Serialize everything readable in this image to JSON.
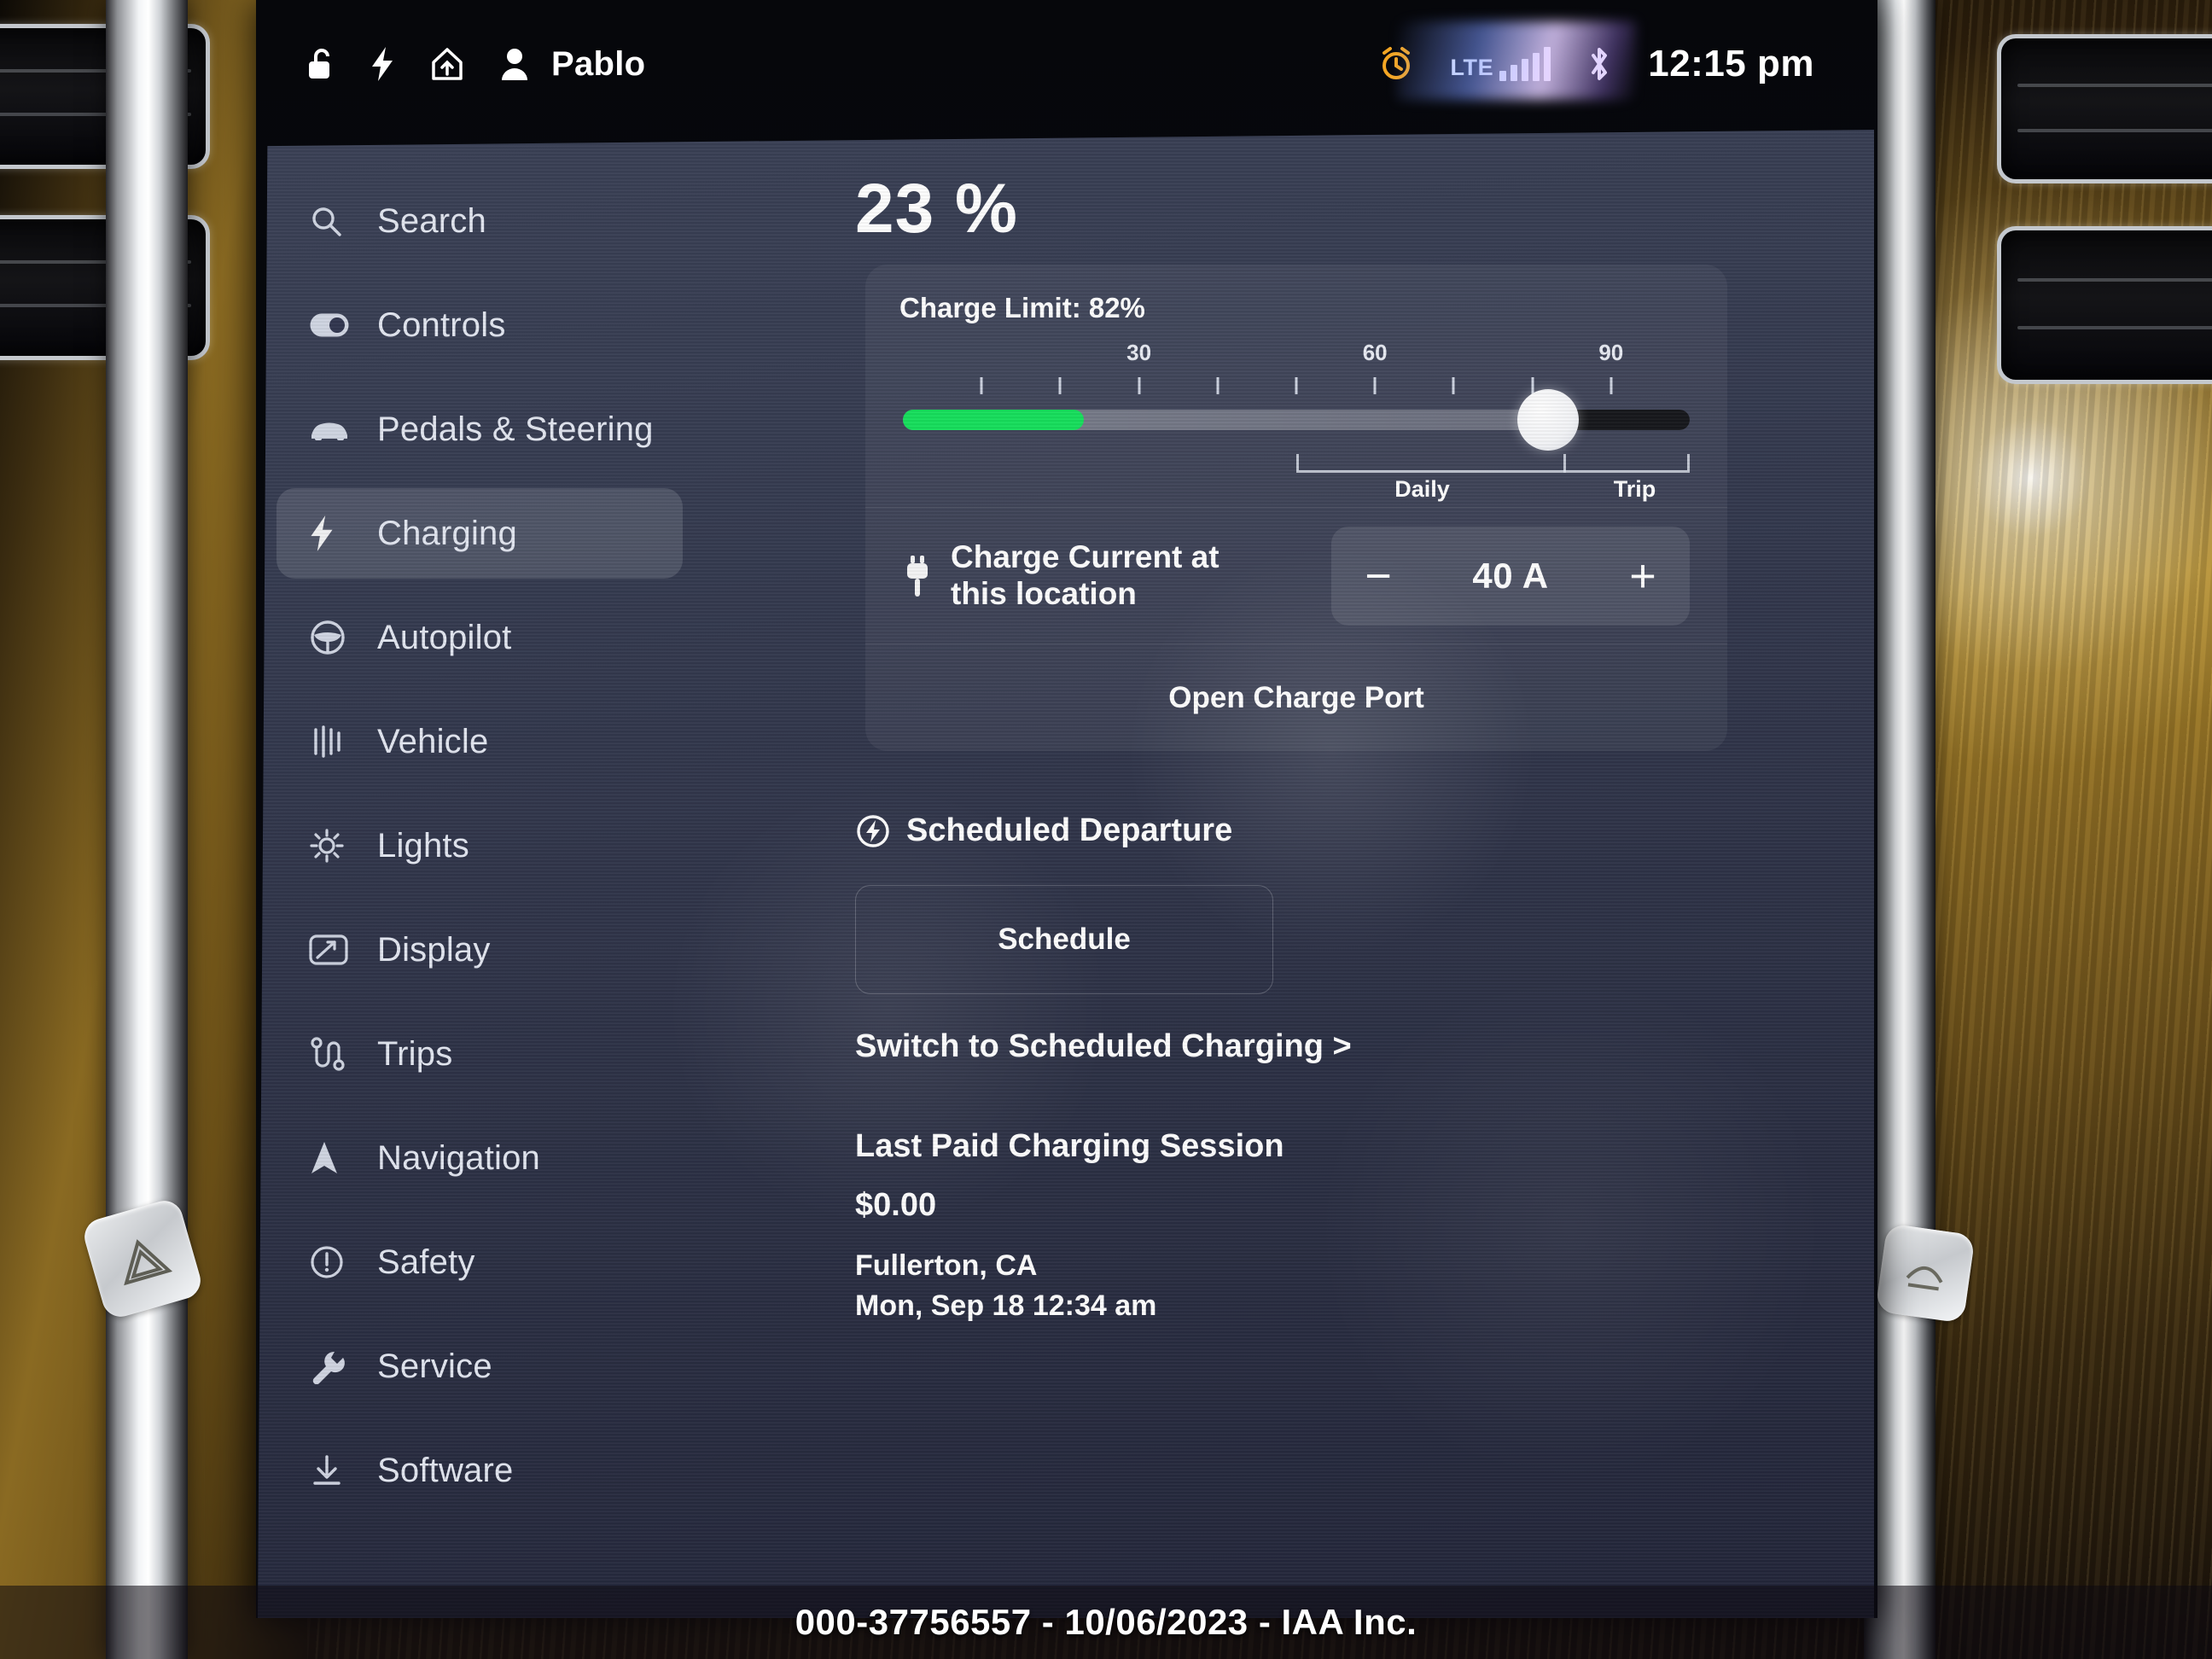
{
  "statusbar": {
    "lock_icon": "unlocked-padlock-icon",
    "bolt_icon": "lightning-bolt-icon",
    "home_icon": "home-icon",
    "profile_icon": "person-icon",
    "user_name": "Pablo",
    "alarm_icon": "alarm-clock-icon",
    "alarm_color": "#F5A623",
    "network_label": "LTE",
    "signal_icon": "signal-bars-icon",
    "bluetooth_icon": "bluetooth-icon",
    "clock": "12:15 pm"
  },
  "sidebar": {
    "items": [
      {
        "label": "Search",
        "icon": "search-icon",
        "active": false
      },
      {
        "label": "Controls",
        "icon": "toggle-icon",
        "active": false
      },
      {
        "label": "Pedals & Steering",
        "icon": "car-icon",
        "active": false
      },
      {
        "label": "Charging",
        "icon": "lightning-bolt-icon",
        "active": true
      },
      {
        "label": "Autopilot",
        "icon": "steering-wheel-icon",
        "active": false
      },
      {
        "label": "Vehicle",
        "icon": "suspension-icon",
        "active": false
      },
      {
        "label": "Lights",
        "icon": "light-bulb-icon",
        "active": false
      },
      {
        "label": "Display",
        "icon": "display-icon",
        "active": false
      },
      {
        "label": "Trips",
        "icon": "route-icon",
        "active": false
      },
      {
        "label": "Navigation",
        "icon": "navigation-arrow-icon",
        "active": false
      },
      {
        "label": "Safety",
        "icon": "alert-circle-icon",
        "active": false
      },
      {
        "label": "Service",
        "icon": "wrench-icon",
        "active": false
      },
      {
        "label": "Software",
        "icon": "download-icon",
        "active": false
      }
    ]
  },
  "charging": {
    "battery_percent": "23 %",
    "charge_limit_label": "Charge Limit: 82%",
    "limit_value": 82,
    "battery_level": 23,
    "accent_green": "#17E05D",
    "ticks": [
      {
        "value": 10,
        "label": ""
      },
      {
        "value": 20,
        "label": ""
      },
      {
        "value": 30,
        "label": "30"
      },
      {
        "value": 40,
        "label": ""
      },
      {
        "value": 50,
        "label": ""
      },
      {
        "value": 60,
        "label": "60"
      },
      {
        "value": 70,
        "label": ""
      },
      {
        "value": 80,
        "label": ""
      },
      {
        "value": 90,
        "label": "90"
      }
    ],
    "range_daily_label": "Daily",
    "range_trip_label": "Trip",
    "current_label_line1": "Charge Current at",
    "current_label_line2": "this location",
    "plug_icon": "charge-plug-icon",
    "decrease_label": "−",
    "increase_label": "+",
    "current_value": "40 A",
    "open_charge_port_label": "Open Charge Port"
  },
  "scheduled": {
    "header": "Scheduled Departure",
    "header_icon": "scheduled-departure-icon",
    "schedule_button": "Schedule",
    "switch_link": "Switch to Scheduled Charging >"
  },
  "last_session": {
    "title": "Last Paid Charging Session",
    "amount": "$0.00",
    "location": "Fullerton, CA",
    "timestamp": "Mon, Sep 18 12:34 am"
  },
  "watermark": "000-37756557 - 10/06/2023 - IAA Inc."
}
